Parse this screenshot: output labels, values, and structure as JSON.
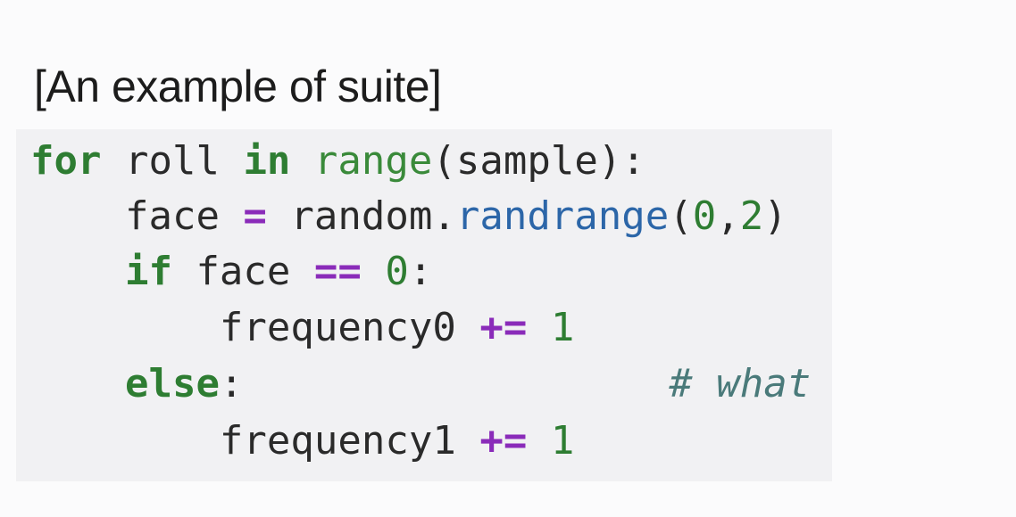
{
  "caption": "[An example of suite]",
  "code": {
    "line1": {
      "kw_for": "for",
      "var_roll": " roll ",
      "kw_in": "in",
      "space": " ",
      "builtin_range": "range",
      "args": "(sample):"
    },
    "line2": {
      "indent": "    ",
      "var_face": "face ",
      "op_assign": "=",
      "obj": " random.",
      "method": "randrange",
      "open": "(",
      "arg0": "0",
      "comma": ",",
      "arg1": "2",
      "close": ")"
    },
    "line3": {
      "indent": "    ",
      "kw_if": "if",
      "var_face": " face ",
      "op_eq": "==",
      "space": " ",
      "num0": "0",
      "colon": ":"
    },
    "line4": {
      "indent": "        ",
      "var": "frequency0 ",
      "op": "+=",
      "space": " ",
      "num": "1"
    },
    "line5": {
      "indent": "    ",
      "kw_else": "else",
      "colon": ":",
      "gap": "                  ",
      "comment": "# what"
    },
    "line6": {
      "indent": "        ",
      "var": "frequency1 ",
      "op": "+=",
      "space": " ",
      "num": "1"
    }
  }
}
